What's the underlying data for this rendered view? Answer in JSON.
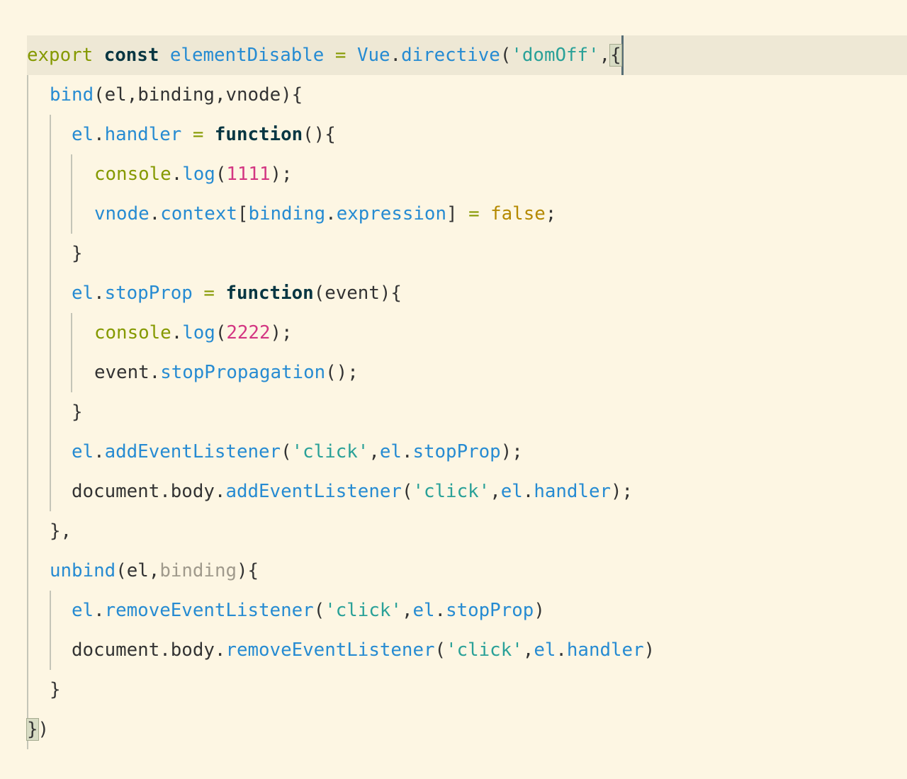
{
  "editor": {
    "lines": [
      {
        "tokens": [
          "export",
          " ",
          "const",
          " ",
          "elementDisable",
          " ",
          "=",
          " ",
          "Vue",
          ".",
          "directive",
          "(",
          "'domOff'",
          ","
        ]
      },
      {
        "tokens": [
          "bind",
          "(el,binding,vnode){"
        ]
      },
      {
        "tokens": [
          "el",
          ".",
          "handler",
          " ",
          "=",
          " ",
          "function",
          "(){"
        ]
      },
      {
        "tokens": [
          "console",
          ".",
          "log",
          "(",
          "1111",
          ");"
        ]
      },
      {
        "tokens": [
          "vnode",
          ".",
          "context",
          "[",
          "binding",
          ".",
          "expression",
          "]",
          " ",
          "=",
          " ",
          "false",
          ";"
        ]
      },
      {
        "tokens": [
          "}"
        ]
      },
      {
        "tokens": [
          "el",
          ".",
          "stopProp",
          " ",
          "=",
          " ",
          "function",
          "(event){"
        ]
      },
      {
        "tokens": [
          "console",
          ".",
          "log",
          "(",
          "2222",
          ");"
        ]
      },
      {
        "tokens": [
          "event",
          ".",
          "stopPropagation",
          "();"
        ]
      },
      {
        "tokens": [
          "}"
        ]
      },
      {
        "tokens": [
          "el",
          ".",
          "addEventListener",
          "(",
          "'click'",
          ",",
          "el",
          ".",
          "stopProp",
          ");"
        ]
      },
      {
        "tokens": [
          "document.body",
          ".",
          "addEventListener",
          "(",
          "'click'",
          ",",
          "el",
          ".",
          "handler",
          ");"
        ]
      },
      {
        "tokens": [
          "},"
        ]
      },
      {
        "tokens": [
          "unbind",
          "(el,",
          "binding",
          "){"
        ]
      },
      {
        "tokens": [
          "el",
          ".",
          "removeEventListener",
          "(",
          "'click'",
          ",",
          "el",
          ".",
          "stopProp",
          ")"
        ]
      },
      {
        "tokens": [
          "document.body",
          ".",
          "removeEventListener",
          "(",
          "'click'",
          ",",
          "el",
          ".",
          "handler",
          ")"
        ]
      },
      {
        "tokens": [
          "}"
        ]
      },
      {
        "tokens": [
          "}",
          ")"
        ]
      }
    ],
    "open_brace": "{"
  },
  "colors": {
    "background": "#fdf6e3",
    "current_line": "#eee8d5",
    "keyword": "#859900",
    "identifier": "#268bd2",
    "string": "#2aa198",
    "number": "#d33682",
    "boolean": "#b58900"
  }
}
